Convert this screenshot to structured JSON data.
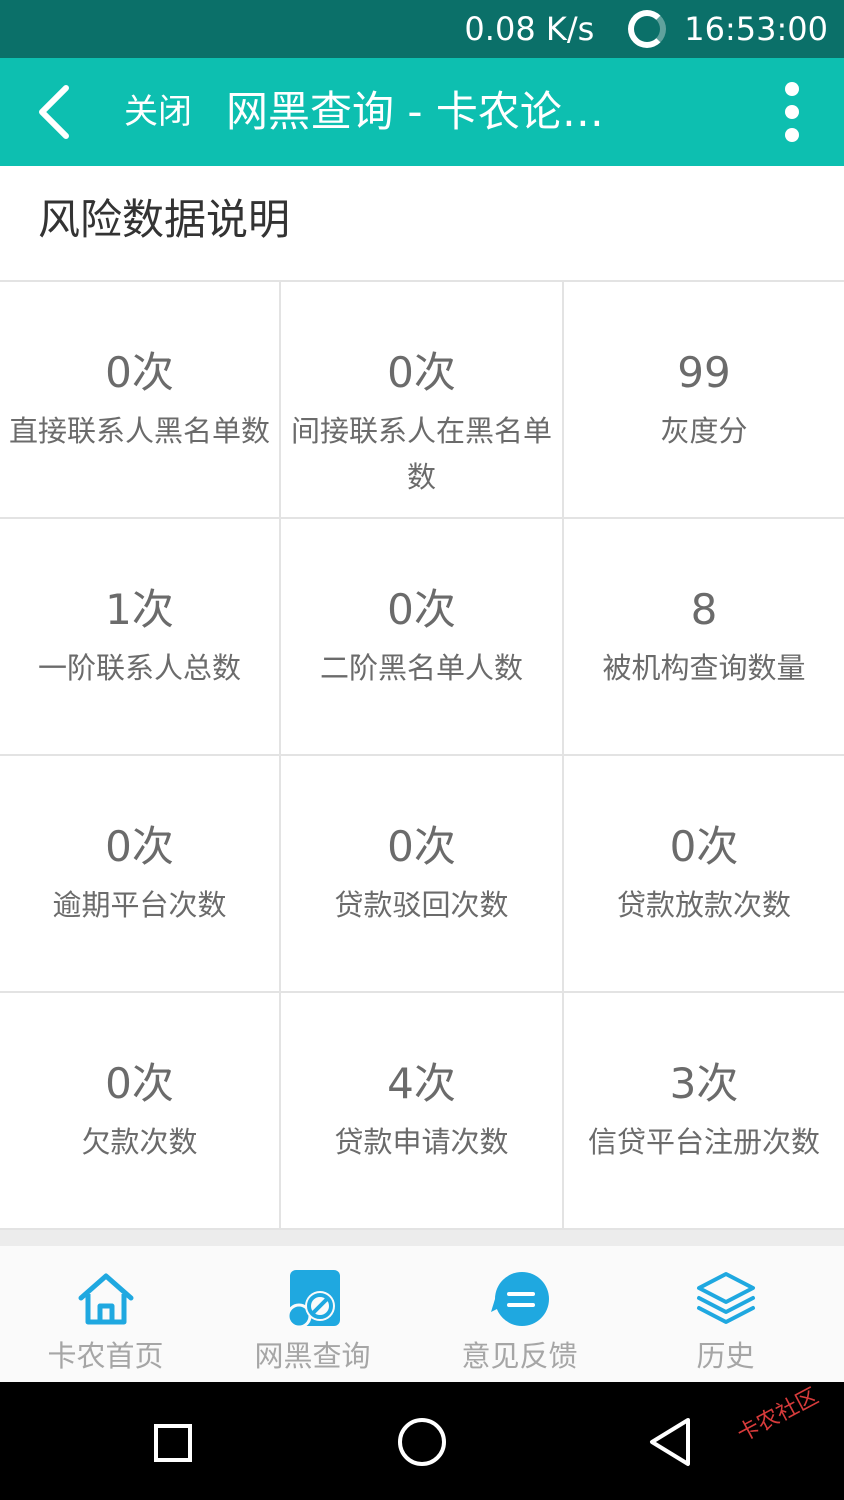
{
  "status_bar": {
    "speed": "0.08 K/s",
    "time": "16:53:00"
  },
  "app_bar": {
    "close_label": "关闭",
    "title": "网黑查询 - 卡农论…"
  },
  "section": {
    "title": "风险数据说明"
  },
  "grid": {
    "cells": [
      {
        "value": "0次",
        "label": "直接联系人黑名单数"
      },
      {
        "value": "0次",
        "label": "间接联系人在黑名单数"
      },
      {
        "value": "99",
        "label": "灰度分"
      },
      {
        "value": "1次",
        "label": "一阶联系人总数"
      },
      {
        "value": "0次",
        "label": "二阶黑名单人数"
      },
      {
        "value": "8",
        "label": "被机构查询数量"
      },
      {
        "value": "0次",
        "label": "逾期平台次数"
      },
      {
        "value": "0次",
        "label": "贷款驳回次数"
      },
      {
        "value": "0次",
        "label": "贷款放款次数"
      },
      {
        "value": "0次",
        "label": "欠款次数"
      },
      {
        "value": "4次",
        "label": "贷款申请次数"
      },
      {
        "value": "3次",
        "label": "信贷平台注册次数"
      }
    ]
  },
  "tabs": [
    {
      "label": "卡农首页",
      "icon": "home-icon"
    },
    {
      "label": "网黑查询",
      "icon": "blacklist-query-icon"
    },
    {
      "label": "意见反馈",
      "icon": "feedback-icon"
    },
    {
      "label": "历史",
      "icon": "layers-icon"
    }
  ],
  "watermark": "卡农社区",
  "colors": {
    "status_bar": "#0b7069",
    "app_bar": "#0dbfb0",
    "tab_icon": "#1fa8e0",
    "text_gray": "#6b6b6b"
  }
}
